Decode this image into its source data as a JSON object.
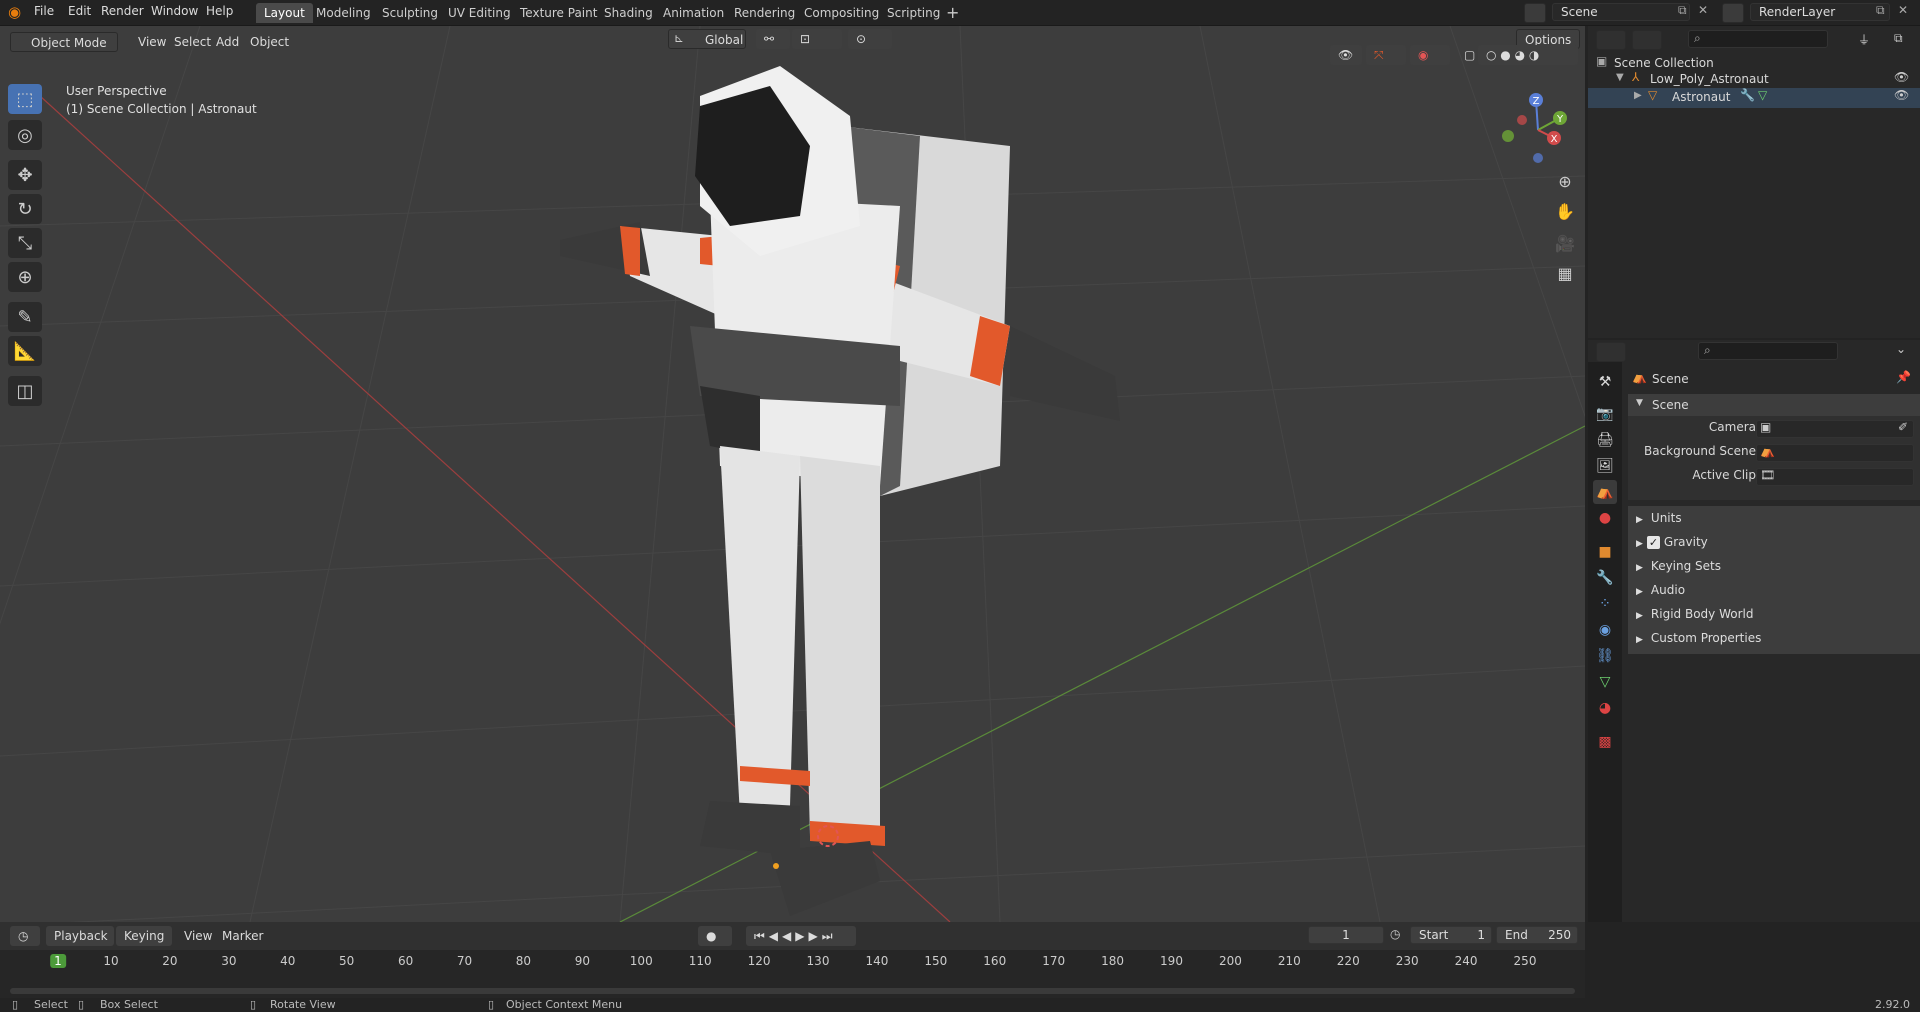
{
  "app": {
    "version": "2.92.0"
  },
  "menu": [
    "File",
    "Edit",
    "Render",
    "Window",
    "Help"
  ],
  "workspaces": [
    "Layout",
    "Modeling",
    "Sculpting",
    "UV Editing",
    "Texture Paint",
    "Shading",
    "Animation",
    "Rendering",
    "Compositing",
    "Scripting"
  ],
  "active_workspace": "Layout",
  "topbar": {
    "scene": "Scene",
    "render_layer": "RenderLayer"
  },
  "viewport": {
    "mode": "Object Mode",
    "menus": [
      "View",
      "Select",
      "Add",
      "Object"
    ],
    "transform_orientation": "Global",
    "options_label": "Options",
    "info_line1": "User Perspective",
    "info_line2": "(1) Scene Collection | Astronaut",
    "gizmo_axes": {
      "z": "Z",
      "y": "Y",
      "x": "X"
    }
  },
  "outliner": {
    "root": "Scene Collection",
    "collection": "Low_Poly_Astronaut",
    "object": "Astronaut"
  },
  "properties": {
    "context": "Scene",
    "panel_title": "Scene",
    "fields": [
      {
        "label": "Camera",
        "value": ""
      },
      {
        "label": "Background Scene",
        "value": ""
      },
      {
        "label": "Active Clip",
        "value": ""
      }
    ],
    "subpanels": [
      "Units",
      "Gravity",
      "Keying Sets",
      "Audio",
      "Rigid Body World",
      "Custom Properties"
    ]
  },
  "timeline": {
    "menus": [
      "Playback",
      "Keying",
      "View",
      "Marker"
    ],
    "current_frame": "1",
    "start_label": "Start",
    "start": "1",
    "end_label": "End",
    "end": "250",
    "ticks": [
      "1",
      "10",
      "20",
      "30",
      "40",
      "50",
      "60",
      "70",
      "80",
      "90",
      "100",
      "110",
      "120",
      "130",
      "140",
      "150",
      "160",
      "170",
      "180",
      "190",
      "200",
      "210",
      "220",
      "230",
      "240",
      "250"
    ]
  },
  "status": {
    "select": "Select",
    "box_select": "Box Select",
    "rotate": "Rotate View",
    "context_menu": "Object Context Menu"
  },
  "colors": {
    "accent": "#4772b3",
    "orange": "#e2592b",
    "suit": "#e6e6e6"
  }
}
